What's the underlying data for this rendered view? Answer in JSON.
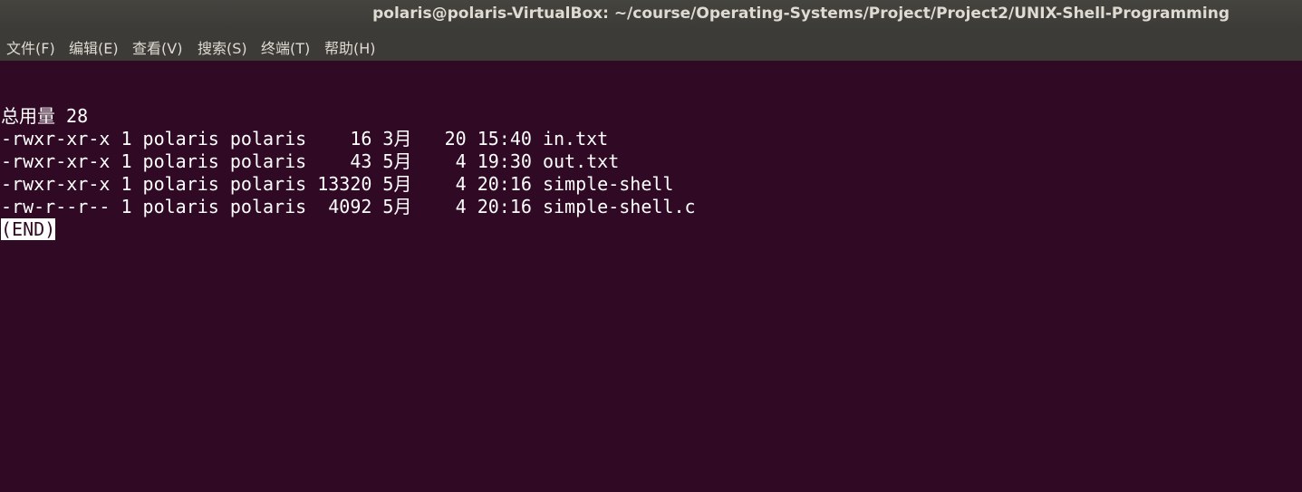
{
  "window": {
    "title": "polaris@polaris-VirtualBox: ~/course/Operating-Systems/Project/Project2/UNIX-Shell-Programming"
  },
  "menubar": {
    "items": [
      {
        "label": "文件(F)"
      },
      {
        "label": "编辑(E)"
      },
      {
        "label": "查看(V)"
      },
      {
        "label": "搜索(S)"
      },
      {
        "label": "终端(T)"
      },
      {
        "label": "帮助(H)"
      }
    ]
  },
  "terminal": {
    "total_line": "总用量 28",
    "lines": [
      "-rwxr-xr-x 1 polaris polaris    16 3月   20 15:40 in.txt",
      "-rwxr-xr-x 1 polaris polaris    43 5月    4 19:30 out.txt",
      "-rwxr-xr-x 1 polaris polaris 13320 5月    4 20:16 simple-shell",
      "-rw-r--r-- 1 polaris polaris  4092 5月    4 20:16 simple-shell.c"
    ],
    "end_marker": "(END)"
  },
  "colors": {
    "terminal_bg": "#300a24",
    "titlebar_bg": "#3c3b37",
    "text": "#ffffff",
    "menu_text": "#dfdbd2"
  }
}
